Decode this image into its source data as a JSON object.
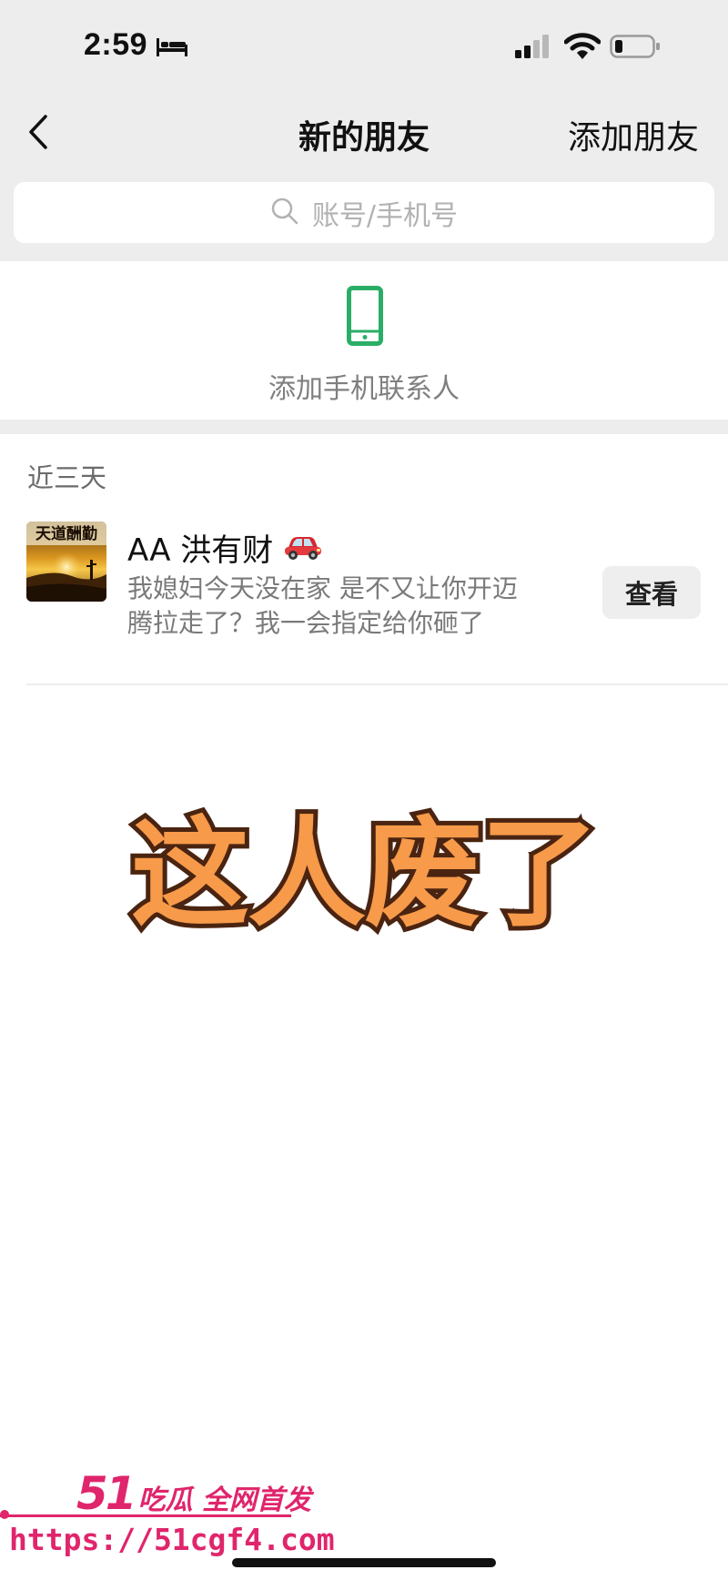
{
  "status_bar": {
    "time": "2:59",
    "icons": [
      "bed-icon",
      "signal-icon",
      "wifi-icon",
      "battery-icon"
    ]
  },
  "nav": {
    "title": "新的朋友",
    "right_action": "添加朋友",
    "back_icon": "chevron-left-icon"
  },
  "search": {
    "placeholder": "账号/手机号",
    "icon": "search-icon"
  },
  "phone_contacts": {
    "label": "添加手机联系人",
    "icon": "phone-icon",
    "icon_color": "#2aae67"
  },
  "recent": {
    "header": "近三天",
    "items": [
      {
        "name": "AA 洪有财",
        "name_emoji_icon": "car-icon",
        "message": "我媳妇今天没在家 是不又让你开迈腾拉走了？我一会指定给你砸了",
        "button_label": "查看",
        "avatar_icon": "avatar-sunset-image",
        "avatar_text": "天道酬勤"
      }
    ]
  },
  "overlay_caption": "这人废了",
  "watermark": {
    "number": "51",
    "text": "吃瓜 全网首发",
    "url": "https://51cgf4.com"
  },
  "colors": {
    "top_background": "#ededed",
    "accent_green": "#2aae67",
    "caption_fill": "#f79a4a",
    "caption_stroke": "#4a2410",
    "watermark": "#e0256c"
  }
}
